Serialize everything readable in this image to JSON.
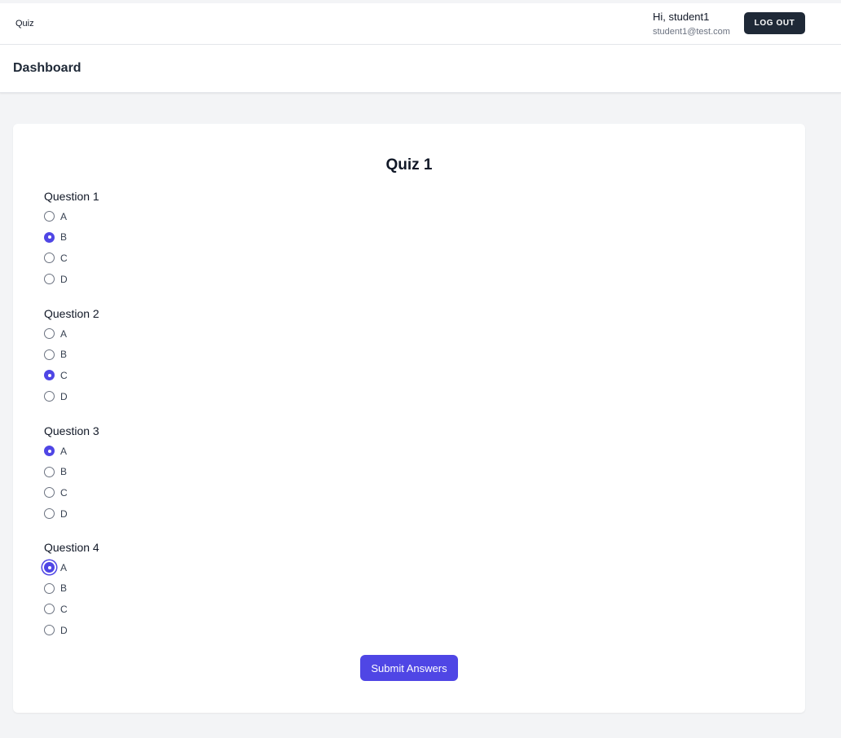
{
  "nav": {
    "brand": "Quiz",
    "greeting": "Hi, student1",
    "email": "student1@test.com",
    "logout_label": "LOG OUT"
  },
  "header": {
    "title": "Dashboard"
  },
  "quiz": {
    "title": "Quiz 1",
    "questions": [
      {
        "title": "Question 1",
        "options": [
          "A",
          "B",
          "C",
          "D"
        ],
        "selected": "B"
      },
      {
        "title": "Question 2",
        "options": [
          "A",
          "B",
          "C",
          "D"
        ],
        "selected": "C"
      },
      {
        "title": "Question 3",
        "options": [
          "A",
          "B",
          "C",
          "D"
        ],
        "selected": "A"
      },
      {
        "title": "Question 4",
        "options": [
          "A",
          "B",
          "C",
          "D"
        ],
        "selected": "A",
        "focused": "A"
      }
    ],
    "submit_label": "Submit Answers"
  },
  "colors": {
    "accent": "#4f46e5",
    "dark_button": "#1f2937",
    "page_bg": "#f3f4f6"
  }
}
